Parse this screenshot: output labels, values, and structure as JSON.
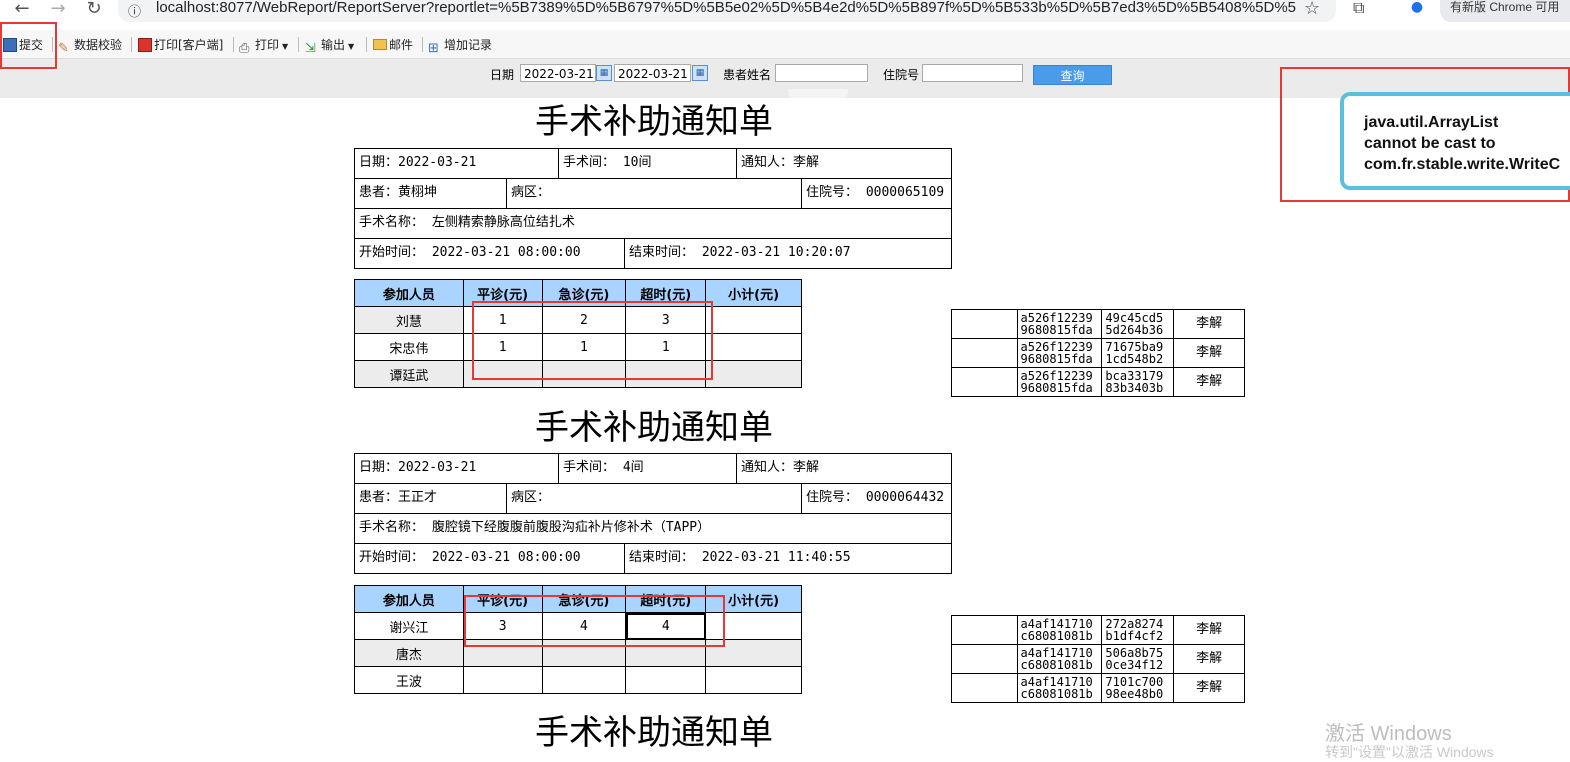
{
  "browser": {
    "url": "localhost:8077/WebReport/ReportServer?reportlet=%5B7389%5D%5B6797%5D%5B5e02%5D%5B4e2d%5D%5B897f%5D%5B533b%5D%5B7ed3%5D%5B5408%5D%5B...",
    "update_button": "有新版 Chrome 可用"
  },
  "toolbar": {
    "submit": "提交",
    "validate": "数据校验",
    "print_client": "打印[客户端]",
    "print": "打印",
    "export": "输出",
    "email": "邮件",
    "add_record": "增加记录"
  },
  "params": {
    "date_label": "日期",
    "date_from": "2022-03-21",
    "date_to": "2022-03-21",
    "patient_label": "患者姓名",
    "patient_value": "",
    "admission_label": "住院号",
    "admission_value": "",
    "query_button": "查询"
  },
  "reports": [
    {
      "title": "手术补助通知单",
      "date": "日期：2022-03-21",
      "room": "手术间： 10间",
      "notifier": "通知人：李解",
      "patient": "患者：黄栩坤",
      "ward": "病区：",
      "admission": "住院号： 0000065109",
      "surgery": "手术名称：  左侧精索静脉高位结扎术",
      "start": "开始时间：  2022-03-21 08:00:00",
      "end": "结束时间：  2022-03-21 10:20:07",
      "headers": [
        "参加人员",
        "平诊(元)",
        "急诊(元)",
        "超时(元)",
        "小计(元)"
      ],
      "rows": [
        {
          "name": "刘慧",
          "normal": "1",
          "emergency": "2",
          "overtime": "3",
          "subtotal": ""
        },
        {
          "name": "宋忠伟",
          "normal": "1",
          "emergency": "1",
          "overtime": "1",
          "subtotal": ""
        },
        {
          "name": "谭廷武",
          "normal": "",
          "emergency": "",
          "overtime": "",
          "subtotal": ""
        }
      ],
      "side_rows": [
        {
          "id1": "a526f12239\n9680815fda",
          "id2": "49c45cd5\n5d264b36",
          "who": "李解"
        },
        {
          "id1": "a526f12239\n9680815fda",
          "id2": "71675ba9\n1cd548b2",
          "who": "李解"
        },
        {
          "id1": "a526f12239\n9680815fda",
          "id2": "bca33179\n83b3403b",
          "who": "李解"
        }
      ]
    },
    {
      "title": "手术补助通知单",
      "date": "日期：2022-03-21",
      "room": "手术间： 4间",
      "notifier": "通知人：李解",
      "patient": "患者：王正才",
      "ward": "病区：",
      "admission": "住院号： 0000064432",
      "surgery": "手术名称：  腹腔镜下经腹腹前腹股沟疝补片修补术（TAPP）",
      "start": "开始时间：  2022-03-21 08:00:00",
      "end": "结束时间：  2022-03-21 11:40:55",
      "headers": [
        "参加人员",
        "平诊(元)",
        "急诊(元)",
        "超时(元)",
        "小计(元)"
      ],
      "rows": [
        {
          "name": "谢兴江",
          "normal": "3",
          "emergency": "4",
          "overtime": "4",
          "subtotal": ""
        },
        {
          "name": "唐杰",
          "normal": "",
          "emergency": "",
          "overtime": "",
          "subtotal": ""
        },
        {
          "name": "王波",
          "normal": "",
          "emergency": "",
          "overtime": "",
          "subtotal": ""
        }
      ],
      "side_rows": [
        {
          "id1": "a4af141710\nc68081081b",
          "id2": "272a8274\nb1df4cf2",
          "who": "李解"
        },
        {
          "id1": "a4af141710\nc68081081b",
          "id2": "506a8b75\n0ce34f12",
          "who": "李解"
        },
        {
          "id1": "a4af141710\nc68081081b",
          "id2": "7101c700\n98ee48b0",
          "who": "李解"
        }
      ]
    },
    {
      "title": "手术补助通知单"
    }
  ],
  "error_toast": {
    "line1": "java.util.ArrayList",
    "line2": "cannot be cast to",
    "line3": "com.fr.stable.write.WriteC"
  },
  "watermark": {
    "line1": "激活 Windows",
    "line2": "转到\"设置\"以激活 Windows"
  },
  "colors": {
    "header_blue": "#a8d4ff",
    "query_blue": "#4a9be8",
    "annotation_red": "#e53935",
    "toast_border": "#5bc0de"
  }
}
